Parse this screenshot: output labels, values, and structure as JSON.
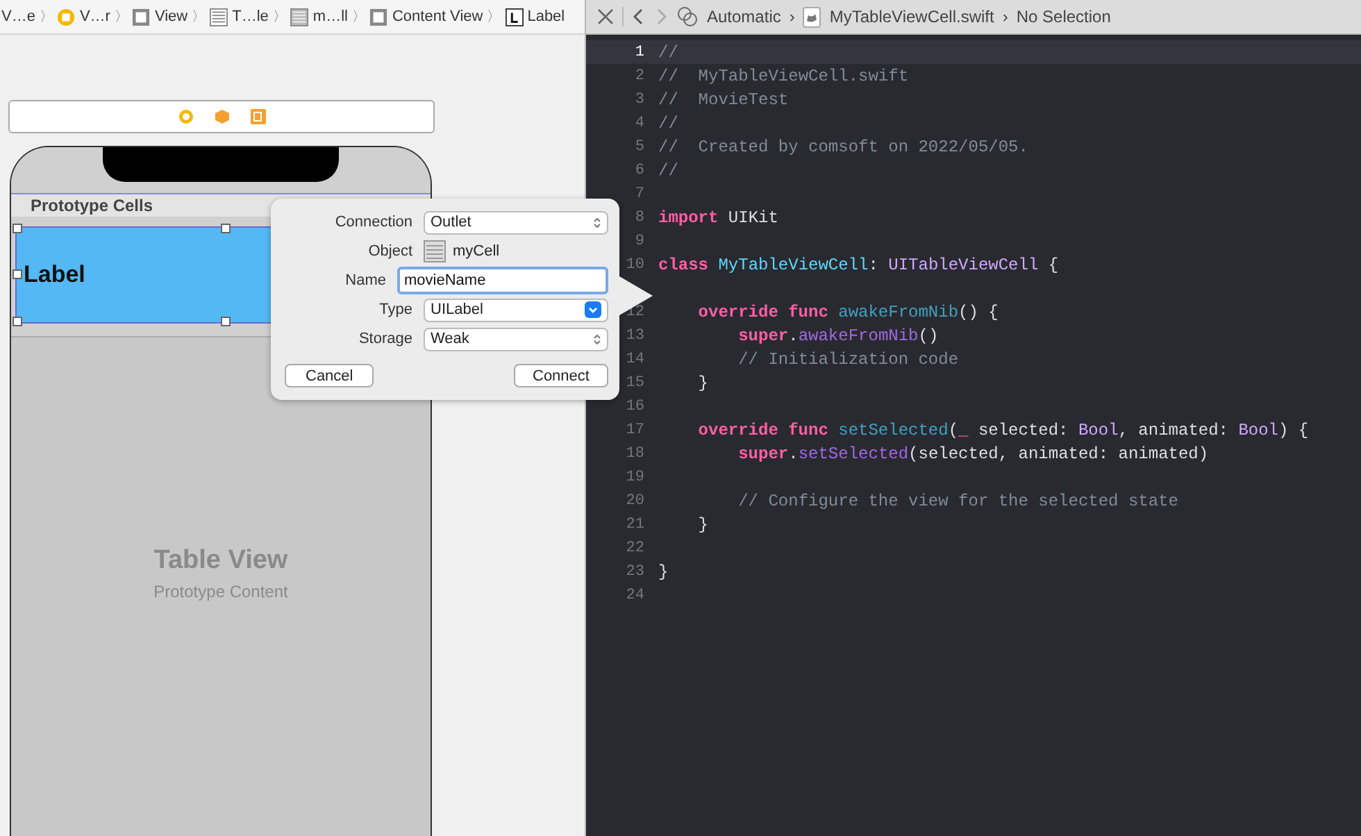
{
  "breadcrumb": [
    {
      "label": "V…e",
      "kind": "none"
    },
    {
      "separator": "〉",
      "label": "V…r",
      "kind": "controller"
    },
    {
      "separator": "〉",
      "label": "View",
      "kind": "view"
    },
    {
      "separator": "〉",
      "label": "T…le",
      "kind": "table"
    },
    {
      "separator": "〉",
      "label": "m…ll",
      "kind": "cell"
    },
    {
      "separator": "〉",
      "label": "Content View",
      "kind": "view"
    },
    {
      "separator": "〉",
      "label": "Label",
      "kind": "label"
    }
  ],
  "canvas": {
    "section_header": "Prototype Cells",
    "cell_label": "Label",
    "table_title": "Table View",
    "table_subtitle": "Prototype Content"
  },
  "outlet_popup": {
    "rows": [
      {
        "label": "Connection",
        "kind": "select",
        "value": "Outlet"
      },
      {
        "label": "Object",
        "kind": "object",
        "value": "myCell"
      },
      {
        "label": "Name",
        "kind": "field",
        "value": "movieName"
      },
      {
        "label": "Type",
        "kind": "combo",
        "value": "UILabel"
      },
      {
        "label": "Storage",
        "kind": "select",
        "value": "Weak"
      }
    ],
    "buttons": [
      "Cancel",
      "Connect"
    ]
  },
  "editor_bar": {
    "mode": "Automatic",
    "mode_separator": "›",
    "file": "MyTableViewCell.swift",
    "file_separator": "›",
    "selection": "No Selection"
  },
  "code": [
    {
      "number": "1",
      "current": true,
      "kind": "top",
      "tokens": [
        {
          "kind": "comment",
          "text": "//"
        }
      ]
    },
    {
      "number": "2",
      "current": false,
      "kind": "top",
      "tokens": [
        {
          "kind": "comment",
          "text": "//  MyTableViewCell.swift"
        }
      ]
    },
    {
      "number": "3",
      "current": false,
      "kind": "top",
      "tokens": [
        {
          "kind": "comment",
          "text": "//  MovieTest"
        }
      ]
    },
    {
      "number": "4",
      "current": false,
      "kind": "top",
      "tokens": [
        {
          "kind": "comment",
          "text": "//"
        }
      ]
    },
    {
      "number": "5",
      "current": false,
      "kind": "top",
      "tokens": [
        {
          "kind": "comment",
          "text": "//  Created by comsoft on 2022/05/05."
        }
      ]
    },
    {
      "number": "6",
      "current": false,
      "kind": "top",
      "tokens": [
        {
          "kind": "comment",
          "text": "//"
        }
      ]
    },
    {
      "number": "7",
      "current": false,
      "kind": "top"
    },
    {
      "number": "8",
      "current": false,
      "kind": "top",
      "tokens": [
        {
          "kind": "keyword",
          "text": "import"
        },
        {
          "kind": "plain",
          "text": " UIKit"
        }
      ]
    },
    {
      "number": "9",
      "current": false,
      "kind": "top"
    },
    {
      "number": "10",
      "current": false,
      "kind": "top",
      "tokens": [
        {
          "kind": "keyword",
          "text": "class"
        },
        {
          "kind": "decl",
          "text": " MyTableViewCell"
        },
        {
          "kind": "plain",
          "text": ":"
        },
        {
          "kind": "type",
          "text": " UITableViewCell"
        },
        {
          "kind": "plain",
          "text": " {"
        }
      ]
    },
    {
      "kind": "top"
    },
    {
      "number": "12",
      "current": false,
      "kind": "member",
      "tokens": [
        {
          "kind": "keyword",
          "text": "override func"
        },
        {
          "kind": "func",
          "text": " awakeFromNib"
        },
        {
          "kind": "plain",
          "text": "() {"
        }
      ]
    },
    {
      "number": "13",
      "current": false,
      "kind": "statement",
      "tokens": [
        {
          "kind": "keyword",
          "text": "super"
        },
        {
          "kind": "plain",
          "text": "."
        },
        {
          "kind": "method",
          "text": "awakeFromNib"
        },
        {
          "kind": "plain",
          "text": "()"
        }
      ]
    },
    {
      "number": "14",
      "current": false,
      "kind": "statement",
      "tokens": [
        {
          "kind": "comment",
          "text": "// Initialization code"
        }
      ]
    },
    {
      "number": "15",
      "current": false,
      "kind": "member",
      "tokens": [
        {
          "kind": "plain",
          "text": "}"
        }
      ]
    },
    {
      "number": "16",
      "current": false,
      "kind": "top"
    },
    {
      "number": "17",
      "current": false,
      "kind": "member",
      "tokens": [
        {
          "kind": "keyword",
          "text": "override func"
        },
        {
          "kind": "func",
          "text": " setSelected"
        },
        {
          "kind": "plain",
          "text": "("
        },
        {
          "kind": "keyword",
          "text": "_"
        },
        {
          "kind": "plain",
          "text": " selected:"
        },
        {
          "kind": "type",
          "text": " Bool"
        },
        {
          "kind": "plain",
          "text": ", animated:"
        },
        {
          "kind": "type",
          "text": " Bool"
        },
        {
          "kind": "plain",
          "text": ") {"
        }
      ]
    },
    {
      "number": "18",
      "current": false,
      "kind": "statement",
      "tokens": [
        {
          "kind": "keyword",
          "text": "super"
        },
        {
          "kind": "plain",
          "text": "."
        },
        {
          "kind": "method",
          "text": "setSelected"
        },
        {
          "kind": "plain",
          "text": "(selected, animated: animated)"
        }
      ]
    },
    {
      "number": "19",
      "current": false,
      "kind": "top"
    },
    {
      "number": "20",
      "current": false,
      "kind": "statement",
      "tokens": [
        {
          "kind": "comment",
          "text": "// Configure the view for the selected state"
        }
      ]
    },
    {
      "number": "21",
      "current": false,
      "kind": "member",
      "tokens": [
        {
          "kind": "plain",
          "text": "}"
        }
      ]
    },
    {
      "number": "22",
      "current": false,
      "kind": "top"
    },
    {
      "number": "23",
      "current": false,
      "kind": "top",
      "tokens": [
        {
          "kind": "plain",
          "text": "}"
        }
      ]
    },
    {
      "number": "24",
      "current": false,
      "kind": "top"
    }
  ]
}
